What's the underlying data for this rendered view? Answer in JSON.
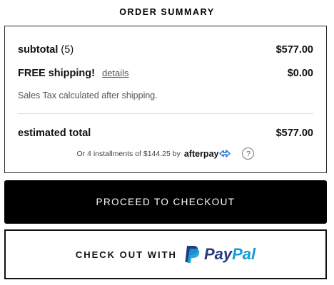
{
  "summary": {
    "title": "ORDER SUMMARY",
    "subtotal_label": "subtotal",
    "subtotal_count": "(5)",
    "subtotal_value": "$577.00",
    "shipping_label": "FREE shipping!",
    "details_link": "details",
    "shipping_value": "$0.00",
    "tax_note": "Sales Tax calculated after shipping.",
    "total_label": "estimated total",
    "total_value": "$577.00",
    "afterpay_text": "Or 4 installments of $144.25 by",
    "afterpay_brand": "afterpay",
    "help_symbol": "?"
  },
  "actions": {
    "checkout_label": "PROCEED TO CHECKOUT",
    "paypal_label": "CHECK OUT WITH",
    "paypal_brand_part1": "Pay",
    "paypal_brand_part2": "Pal"
  },
  "colors": {
    "checkout_bg": "#000000",
    "paypal_dark": "#253b80",
    "paypal_light": "#179bd7"
  },
  "icons": {
    "afterpay_logo": "afterpay-arrows-icon",
    "help": "help-circle-icon",
    "paypal_mark": "paypal-p-icon"
  }
}
